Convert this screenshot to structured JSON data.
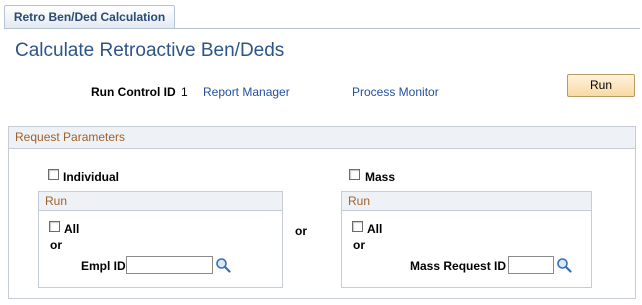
{
  "tab": {
    "label": "Retro Ben/Ded Calculation"
  },
  "page": {
    "title": "Calculate Retroactive Ben/Deds"
  },
  "run_control": {
    "label": "Run Control ID",
    "value": "1",
    "report_manager": "Report Manager",
    "process_monitor": "Process Monitor",
    "run_button": "Run"
  },
  "request_parameters": {
    "title": "Request Parameters",
    "or": "or",
    "individual": {
      "label": "Individual",
      "checked": false,
      "run_title": "Run",
      "all_label": "All",
      "or_label": "or",
      "empl_id_label": "Empl ID",
      "empl_id_value": ""
    },
    "mass": {
      "label": "Mass",
      "checked": false,
      "run_title": "Run",
      "all_label": "All",
      "or_label": "or",
      "mass_request_id_label": "Mass Request ID",
      "mass_request_id_value": ""
    }
  },
  "colors": {
    "title": "#2d5486",
    "link": "#2350a0",
    "group_header_text": "#a0612a",
    "run_button_bg": "#f9d9a3"
  },
  "icons": {
    "lookup": "magnifier-icon"
  }
}
